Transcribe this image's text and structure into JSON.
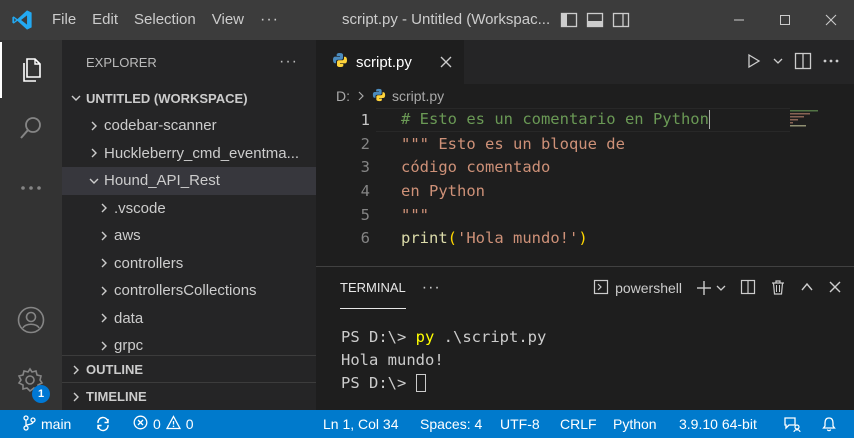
{
  "menu": {
    "file": "File",
    "edit": "Edit",
    "selection": "Selection",
    "view": "View",
    "more": "···"
  },
  "window": {
    "title": "script.py - Untitled (Workspac..."
  },
  "sidebar": {
    "title": "EXPLORER",
    "more": "···",
    "workspace": "UNTITLED (WORKSPACE)",
    "items": [
      {
        "label": "codebar-scanner"
      },
      {
        "label": "Huckleberry_cmd_eventma..."
      },
      {
        "label": "Hound_API_Rest"
      },
      {
        "label": ".vscode"
      },
      {
        "label": "aws"
      },
      {
        "label": "controllers"
      },
      {
        "label": "controllersCollections"
      },
      {
        "label": "data"
      },
      {
        "label": "grpc"
      }
    ],
    "outline": "OUTLINE",
    "timeline": "TIMELINE"
  },
  "activity": {
    "badge": "1"
  },
  "editor": {
    "tab_label": "script.py",
    "breadcrumb_drive": "D:",
    "breadcrumb_file": "script.py",
    "lines": [
      {
        "num": "1",
        "text": "# Esto es un comentario en Python"
      },
      {
        "num": "2",
        "text": "\"\"\" Esto es un bloque de"
      },
      {
        "num": "3",
        "text": "código comentado"
      },
      {
        "num": "4",
        "text": "en Python"
      },
      {
        "num": "5",
        "text": "\"\"\""
      },
      {
        "num": "6",
        "func": "print",
        "open": "(",
        "str": "'Hola mundo!'",
        "close": ")"
      }
    ]
  },
  "panel": {
    "tab": "TERMINAL",
    "more": "···",
    "shell": "powershell",
    "prompt1": "PS D:\\> ",
    "cmd1": "py",
    "args1": " .\\script.py",
    "output1": "Hola mundo!",
    "prompt2": "PS D:\\> "
  },
  "statusbar": {
    "branch": "main",
    "errors": "0",
    "warnings": "0",
    "position": "Ln 1, Col 34",
    "spaces": "Spaces: 4",
    "encoding": "UTF-8",
    "eol": "CRLF",
    "language": "Python",
    "interpreter": "3.9.10 64-bit"
  },
  "colors": {
    "accent": "#007acc",
    "titlebar": "#3c3c3c",
    "activitybar": "#333333",
    "sidebar": "#252526",
    "editor": "#1e1e1e",
    "comment": "#6a9955",
    "string": "#ce9178",
    "function": "#dcdcaa",
    "bracket": "#ffd700"
  },
  "icons": [
    "vscode-logo-icon",
    "explorer-icon",
    "search-icon",
    "more-icon",
    "account-icon",
    "manage-gear-icon",
    "python-file-icon",
    "close-icon",
    "run-icon",
    "split-editor-icon",
    "terminal-icon",
    "add-icon",
    "trash-icon",
    "chevron-up-icon",
    "branch-icon",
    "sync-icon",
    "error-icon",
    "warning-icon",
    "feedback-icon",
    "bell-icon"
  ]
}
